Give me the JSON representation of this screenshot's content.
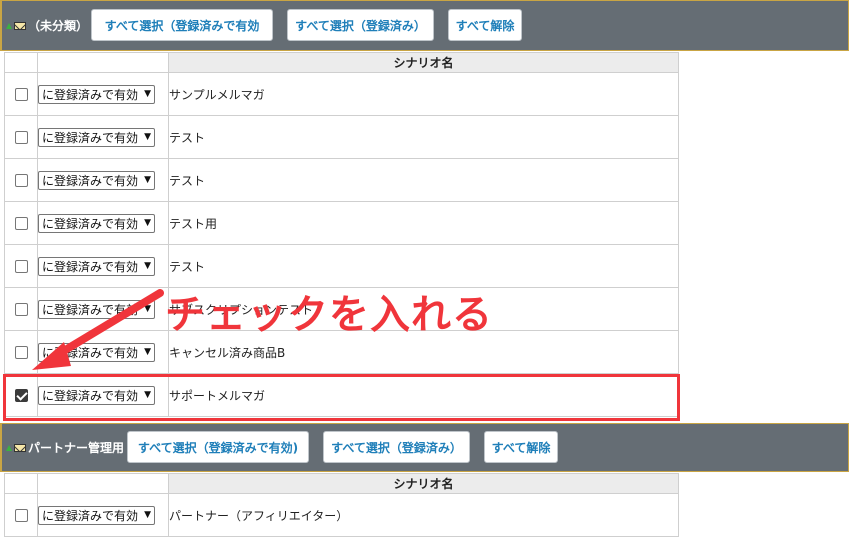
{
  "groups": [
    {
      "title": "（未分類）",
      "buttons": {
        "select_all_valid": "すべて選択（登録済みで有効",
        "select_all_registered": "すべて選択（登録済み）",
        "deselect_all": "すべて解除"
      },
      "column_header": "シナリオ名",
      "rows": [
        {
          "checked": false,
          "select_value": "に登録済みで有効",
          "name": "サンプルメルマガ"
        },
        {
          "checked": false,
          "select_value": "に登録済みで有効",
          "name": "テスト"
        },
        {
          "checked": false,
          "select_value": "に登録済みで有効",
          "name": "テスト"
        },
        {
          "checked": false,
          "select_value": "に登録済みで有効",
          "name": "テスト用"
        },
        {
          "checked": false,
          "select_value": "に登録済みで有効",
          "name": "テスト"
        },
        {
          "checked": false,
          "select_value": "に登録済みで有効",
          "name": "サブスクリプションテスト"
        },
        {
          "checked": false,
          "select_value": "に登録済みで有効",
          "name": "キャンセル済み商品B"
        },
        {
          "checked": true,
          "select_value": "に登録済みで有効",
          "name": "サポートメルマガ"
        }
      ]
    },
    {
      "title": "パートナー管理用",
      "buttons": {
        "select_all_valid": "すべて選択（登録済みで有効)",
        "select_all_registered": "すべて選択（登録済み）",
        "deselect_all": "すべて解除"
      },
      "column_header": "シナリオ名",
      "rows": [
        {
          "checked": false,
          "select_value": "に登録済みで有効",
          "name": "パートナー（アフィリエイター）"
        }
      ]
    }
  ],
  "annotation": {
    "text": "チェックを入れる",
    "color": "#f0353b"
  },
  "colors": {
    "header_bg": "#656d74",
    "header_border": "#c9a544",
    "button_text": "#1f7fb9"
  }
}
